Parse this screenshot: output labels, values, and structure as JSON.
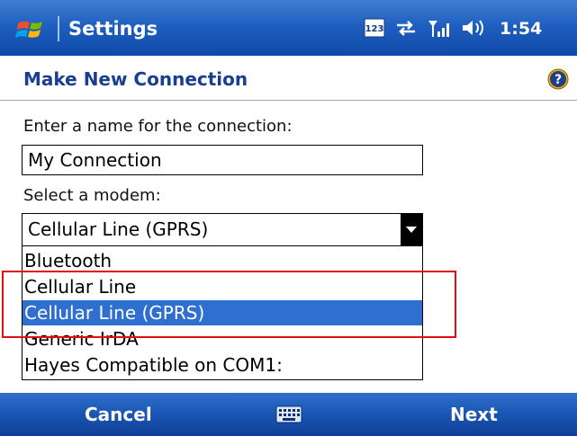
{
  "titlebar": {
    "title": "Settings",
    "time": "1:54",
    "status_icons": [
      "input-123-icon",
      "connectivity-icon",
      "signal-strength-icon",
      "volume-icon"
    ]
  },
  "header": {
    "title": "Make New Connection",
    "help_icon": "help-icon"
  },
  "form": {
    "name_label": "Enter a name for the connection:",
    "name_value": "My Connection",
    "modem_label": "Select a modem:",
    "modem_selected": "Cellular Line (GPRS)",
    "modem_options": [
      "Bluetooth",
      "Cellular Line",
      "Cellular Line (GPRS)",
      "Generic IrDA",
      "Hayes Compatible on COM1:"
    ]
  },
  "softkeys": {
    "left": "Cancel",
    "right": "Next",
    "center_icon": "keyboard-icon"
  },
  "colors": {
    "titlebar": "#1f5fbf",
    "selection": "#2f6fd0",
    "header_text": "#1a3f8f",
    "annotation": "#e01010"
  }
}
